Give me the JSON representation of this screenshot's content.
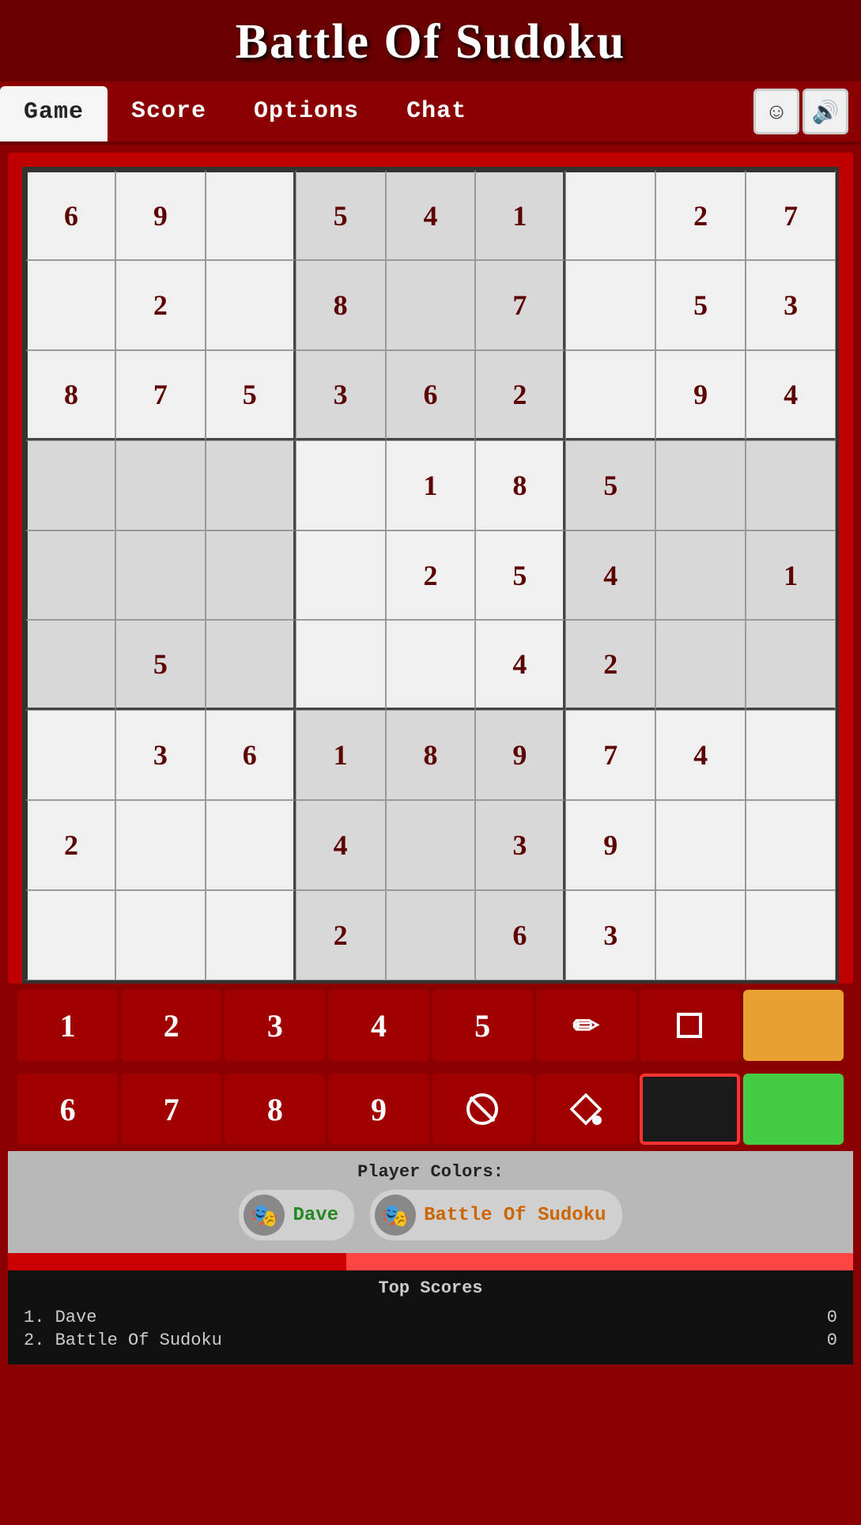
{
  "header": {
    "title": "Battle Of Sudoku"
  },
  "nav": {
    "tabs": [
      {
        "id": "game",
        "label": "Game",
        "active": true
      },
      {
        "id": "score",
        "label": "Score",
        "active": false
      },
      {
        "id": "options",
        "label": "Options",
        "active": false
      },
      {
        "id": "chat",
        "label": "Chat",
        "active": false
      }
    ],
    "emoji_icon": "☺",
    "sound_icon": "🔊"
  },
  "sudoku": {
    "grid": [
      [
        6,
        9,
        0,
        5,
        4,
        1,
        0,
        2,
        7
      ],
      [
        0,
        2,
        0,
        8,
        0,
        7,
        0,
        5,
        3
      ],
      [
        8,
        7,
        5,
        3,
        6,
        2,
        0,
        9,
        4
      ],
      [
        0,
        0,
        0,
        0,
        1,
        8,
        5,
        0,
        0
      ],
      [
        0,
        0,
        0,
        0,
        2,
        5,
        4,
        0,
        1
      ],
      [
        0,
        5,
        0,
        0,
        0,
        4,
        2,
        0,
        0
      ],
      [
        0,
        3,
        6,
        1,
        8,
        9,
        7,
        4,
        0
      ],
      [
        2,
        0,
        0,
        4,
        0,
        3,
        9,
        0,
        0
      ],
      [
        0,
        0,
        0,
        2,
        0,
        6,
        3,
        0,
        0
      ]
    ]
  },
  "numpad": {
    "row1": [
      {
        "type": "number",
        "value": "1"
      },
      {
        "type": "number",
        "value": "2"
      },
      {
        "type": "number",
        "value": "3"
      },
      {
        "type": "number",
        "value": "4"
      },
      {
        "type": "number",
        "value": "5"
      },
      {
        "type": "icon",
        "value": "✏",
        "name": "pencil"
      },
      {
        "type": "icon",
        "value": "□",
        "name": "square"
      },
      {
        "type": "color",
        "value": "",
        "name": "orange-color",
        "color": "#e8a030"
      }
    ],
    "row2": [
      {
        "type": "number",
        "value": "6"
      },
      {
        "type": "number",
        "value": "7"
      },
      {
        "type": "number",
        "value": "8"
      },
      {
        "type": "number",
        "value": "9"
      },
      {
        "type": "icon",
        "value": "⊘",
        "name": "no-symbol"
      },
      {
        "type": "icon",
        "value": "◇",
        "name": "diamond-fill"
      },
      {
        "type": "color",
        "value": "",
        "name": "black-color",
        "color": "#1a1a1a",
        "active": true
      },
      {
        "type": "color",
        "value": "",
        "name": "green-color",
        "color": "#44cc44"
      }
    ]
  },
  "player_colors": {
    "label": "Player Colors:",
    "players": [
      {
        "name": "Dave",
        "avatar": "🎭",
        "name_color": "green"
      },
      {
        "name": "Battle Of Sudoku",
        "avatar": "🎭",
        "name_color": "orange"
      }
    ]
  },
  "top_scores": {
    "title": "Top Scores",
    "entries": [
      {
        "rank": "1.",
        "name": "Dave",
        "score": "0"
      },
      {
        "rank": "2.",
        "name": "Battle Of Sudoku",
        "score": "0"
      }
    ]
  }
}
